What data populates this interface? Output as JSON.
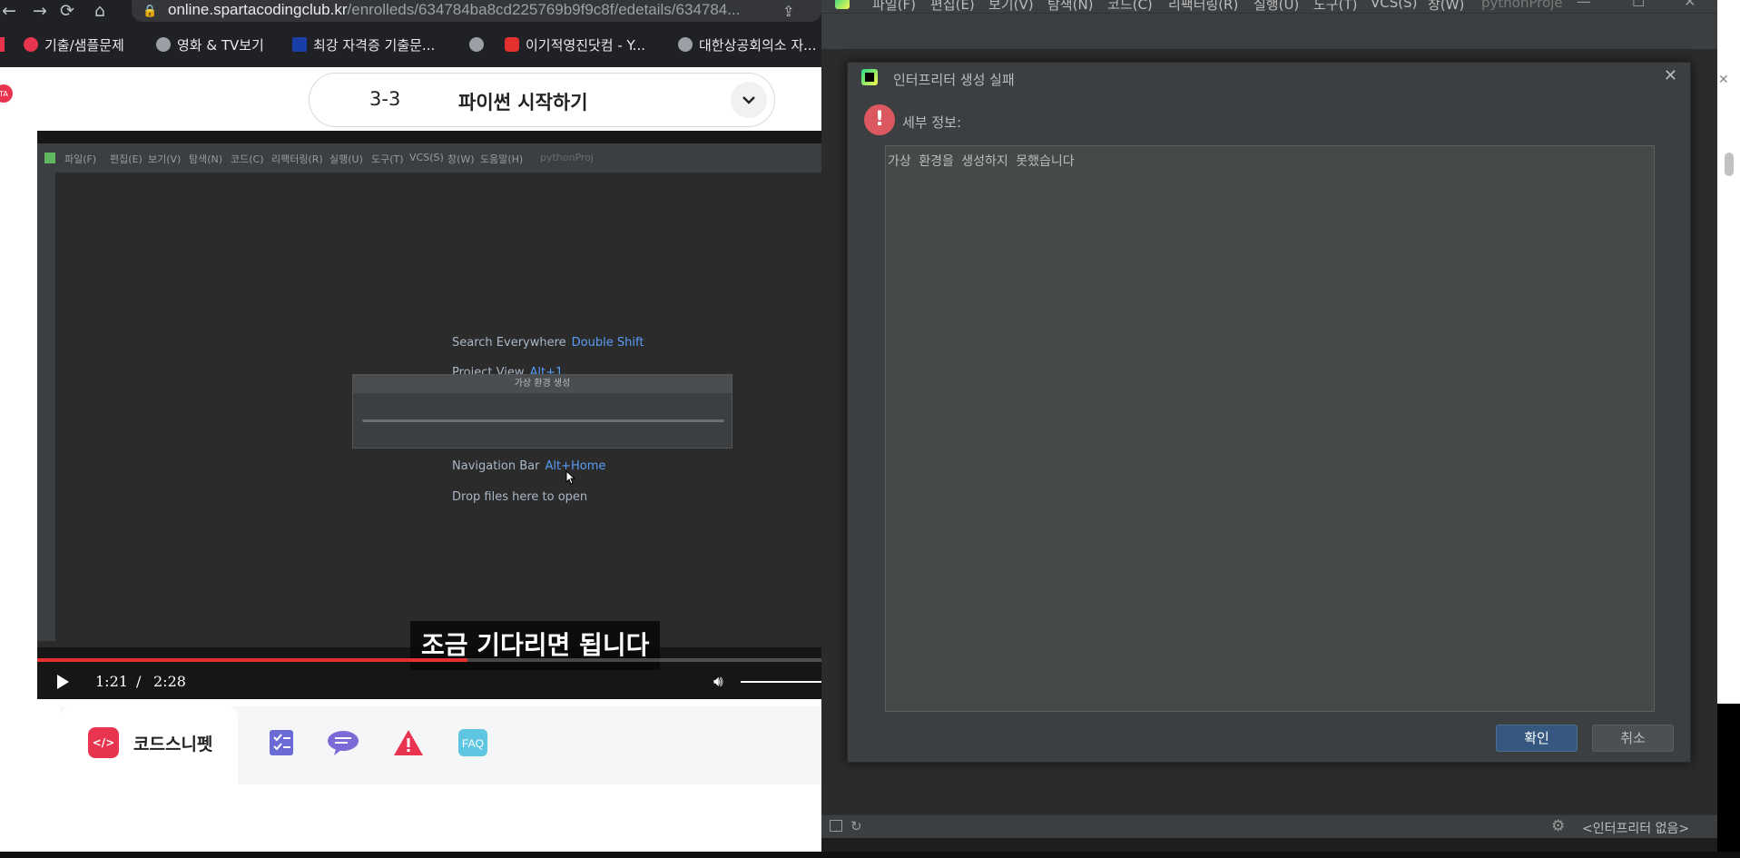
{
  "browser": {
    "url_host": "online.spartacodingclub.kr",
    "url_path": "/enrolleds/634784ba8cd225769b9f9c8f/edetails/634784...",
    "bookmarks": [
      {
        "label": "기출/샘플문제",
        "color": "#e8344e"
      },
      {
        "label": "영화 & TV보기",
        "color": "#9aa0a6"
      },
      {
        "label": "최강 자격증 기출문...",
        "color": "#1a3ea8"
      },
      {
        "label": "",
        "color": "#9aa0a6"
      },
      {
        "label": "이기적영진닷컴 - Y...",
        "color": "#e53030"
      },
      {
        "label": "대한상공회의소 자...",
        "color": "#9aa0a6"
      }
    ]
  },
  "lesson": {
    "number": "3-3",
    "title": "파이썬 시작하기"
  },
  "video": {
    "ide_menu": [
      "파일(F)",
      "편집(E)",
      "보기(V)",
      "탐색(N)",
      "코드(C)",
      "리팩터링(R)",
      "실행(U)",
      "도구(T)",
      "VCS(S)",
      "창(W)",
      "도움말(H)",
      "pythonProj"
    ],
    "tips": [
      {
        "label": "Search Everywhere",
        "key": "Double Shift"
      },
      {
        "label": "Project View",
        "key": "Alt+1"
      },
      {
        "label": "Navigation Bar",
        "key": "Alt+Home"
      },
      {
        "label": "Drop files here to open",
        "key": ""
      }
    ],
    "venv_dialog_title": "가상 환경 생성",
    "subtitle": "조금 기다리면 됩니다",
    "current_time": "1:21",
    "separator": "/",
    "duration": "2:28",
    "progress": 0.545
  },
  "tabs": {
    "snippet_label": "코드스니펫",
    "faq_label": "FAQ"
  },
  "pycharm": {
    "menu": [
      "파일(F)",
      "편집(E)",
      "보기(V)",
      "탐색(N)",
      "코드(C)",
      "리팩터링(R)",
      "실행(U)",
      "도구(T)",
      "VCS(S)",
      "창(W)"
    ],
    "project": "pythonProje",
    "dialog": {
      "title": "인터프리터 생성 실패",
      "details_label": "세부 정보:",
      "message": "가상 환경을 생성하지 못했습니다",
      "ok_label": "확인",
      "cancel_label": "취소"
    },
    "status_interpreter": "<인터프리터 없음>"
  }
}
